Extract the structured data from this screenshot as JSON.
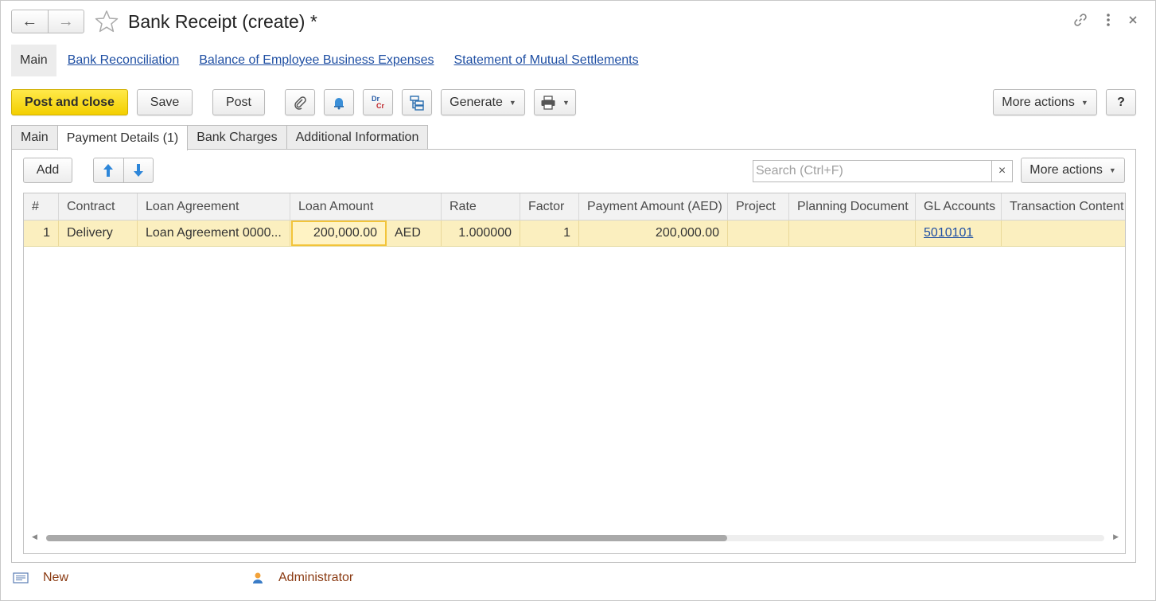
{
  "window": {
    "title": "Bank Receipt (create) *"
  },
  "panel": {
    "main": "Main",
    "links": [
      "Bank Reconciliation",
      "Balance of Employee Business Expenses",
      "Statement of Mutual Settlements"
    ]
  },
  "commands": {
    "post_and_close": "Post and close",
    "save": "Save",
    "post": "Post",
    "dr": "Dr",
    "cr": "Cr",
    "generate": "Generate",
    "more_actions": "More actions",
    "help": "?"
  },
  "tabs": [
    "Main",
    "Payment Details (1)",
    "Bank Charges",
    "Additional Information"
  ],
  "table_toolbar": {
    "add": "Add",
    "search_placeholder": "Search (Ctrl+F)",
    "clear": "×",
    "more_actions": "More actions"
  },
  "grid": {
    "columns": [
      "#",
      "Contract",
      "Loan Agreement",
      "Loan Amount",
      "Rate",
      "Factor",
      "Payment Amount (AED)",
      "Project",
      "Planning Document",
      "GL Accounts",
      "Transaction Content"
    ],
    "rows": [
      {
        "num": "1",
        "contract": "Delivery",
        "loan_agreement": "Loan Agreement 0000...",
        "loan_amount": "200,000.00",
        "currency": "AED",
        "rate": "1.000000",
        "factor": "1",
        "payment_amount": "200,000.00",
        "project": "",
        "planning_document": "",
        "gl_accounts": "5010101",
        "transaction_content": ""
      }
    ]
  },
  "footer": {
    "status": "New",
    "user": "Administrator"
  },
  "colors": {
    "accent_yellow": "#f3cf00",
    "link_blue": "#1f4fa3",
    "row_highlight": "#fbefbf",
    "footer_text": "#8a3a12"
  }
}
